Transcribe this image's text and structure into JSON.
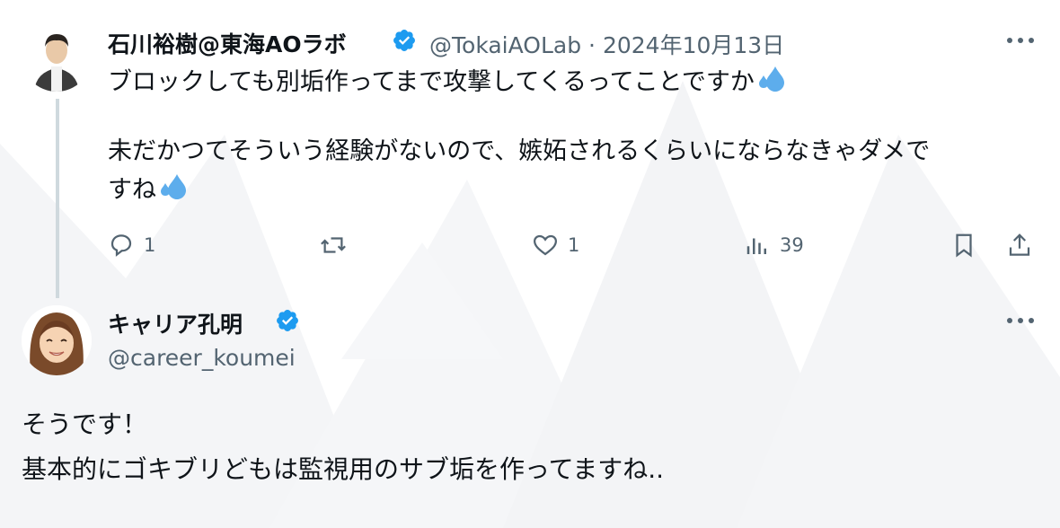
{
  "tweet1": {
    "author_name": "石川裕樹@東海AOラボ",
    "handle": "@TokaiAOLab",
    "separator": "·",
    "date": "2024年10月13日",
    "line1": "ブロックしても別垢作ってまで攻撃してくるってことですか",
    "line2": "未だかつてそういう経験がないので、嫉妬されるくらいにならなきゃダメで",
    "line3": "すね",
    "emoji_name": "sweat-droplets",
    "replies": "1",
    "retweets": "",
    "likes": "1",
    "views": "39"
  },
  "tweet2": {
    "author_name": "キャリア孔明",
    "handle": "@career_koumei",
    "line1": "そうです！",
    "line2": "基本的にゴキブリどもは監視用のサブ垢を作ってますね.."
  },
  "colors": {
    "verified": "#1d9bf0",
    "secondary_text": "#536471",
    "thread_line": "#cfd9de"
  }
}
